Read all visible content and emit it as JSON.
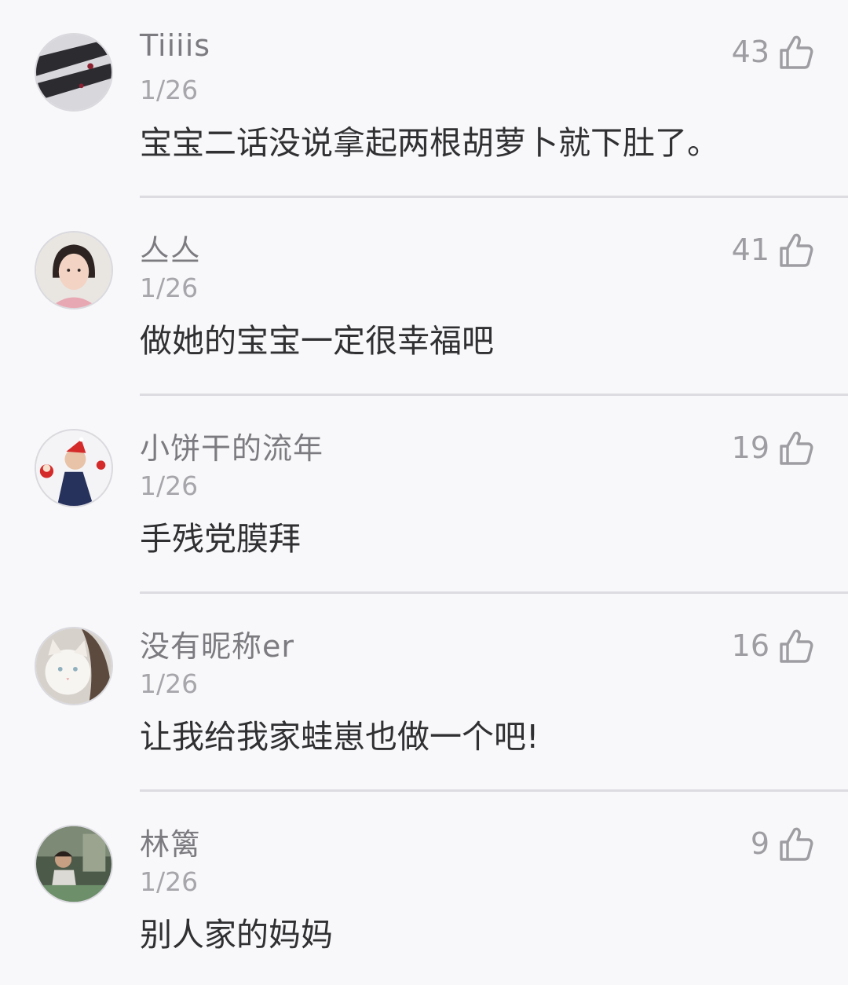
{
  "comments": [
    {
      "username": "Tiiiis",
      "date": "1/26",
      "content": "宝宝二话没说拿起两根胡萝卜就下肚了。",
      "likes": "43"
    },
    {
      "username": "亼亼",
      "date": "1/26",
      "content": "做她的宝宝一定很幸福吧",
      "likes": "41"
    },
    {
      "username": "小饼干的流年",
      "date": "1/26",
      "content": "手残党膜拜",
      "likes": "19"
    },
    {
      "username": "没有昵称er",
      "date": "1/26",
      "content": "让我给我家蛙崽也做一个吧!",
      "likes": "16"
    },
    {
      "username": "林篱",
      "date": "1/26",
      "content": "别人家的妈妈",
      "likes": "9"
    }
  ],
  "icons": {
    "like": "thumbs-up-icon"
  },
  "colors": {
    "background": "#f8f8fa",
    "text": "#303033",
    "meta": "#a6a6ab",
    "divider": "#dcdce1"
  }
}
